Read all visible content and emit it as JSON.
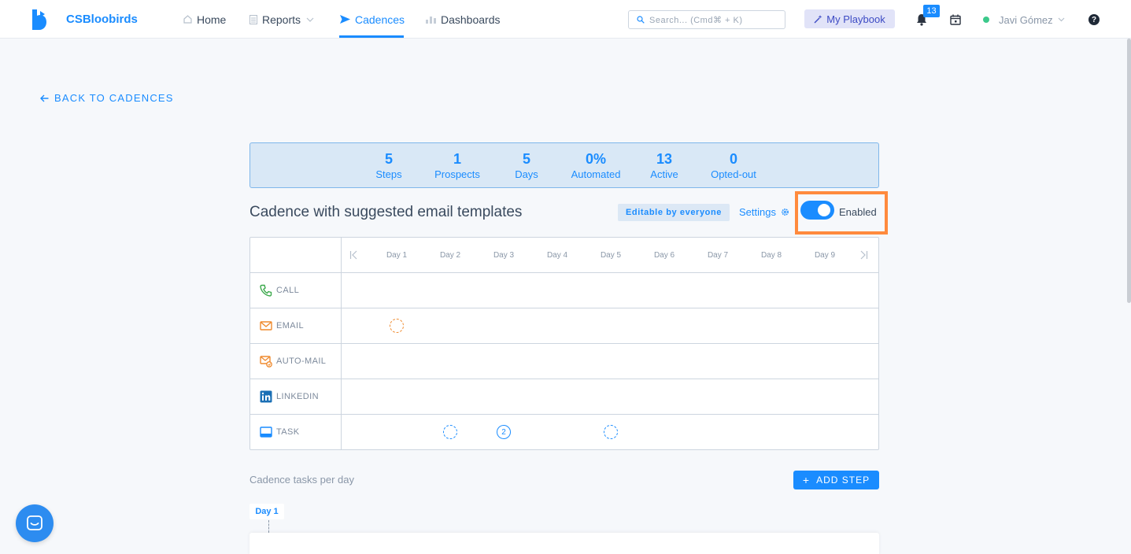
{
  "app": {
    "brand": "CSBloobirds"
  },
  "nav": {
    "items": [
      {
        "label": "Home",
        "icon": "home-icon"
      },
      {
        "label": "Reports",
        "icon": "reports-icon"
      },
      {
        "label": "Cadences",
        "icon": "send-icon",
        "active": true
      },
      {
        "label": "Dashboards",
        "icon": "bar-chart-icon"
      }
    ]
  },
  "search": {
    "placeholder": "Search... (Cmd⌘ + K)"
  },
  "playbook": {
    "label": "My Playbook"
  },
  "notifications": {
    "count": "13"
  },
  "user": {
    "name": "Javi Gómez",
    "status_color": "#3cc98b"
  },
  "help": {
    "glyph": "?"
  },
  "back_link": {
    "label": "BACK TO CADENCES"
  },
  "stats": [
    {
      "value": "5",
      "label": "Steps"
    },
    {
      "value": "1",
      "label": "Prospects"
    },
    {
      "value": "5",
      "label": "Days"
    },
    {
      "value": "0%",
      "label": "Automated"
    },
    {
      "value": "13",
      "label": "Active"
    },
    {
      "value": "0",
      "label": "Opted-out"
    }
  ],
  "cadence": {
    "title": "Cadence with suggested email templates",
    "editable_badge": "Editable by everyone",
    "settings_label": "Settings",
    "enabled_label": "Enabled",
    "enabled": true
  },
  "grid": {
    "days": [
      "Day 1",
      "Day 2",
      "Day 3",
      "Day 4",
      "Day 5",
      "Day 6",
      "Day 7",
      "Day 8",
      "Day 9"
    ],
    "rows": [
      {
        "label": "CALL",
        "icon": "phone-icon",
        "color": "#3aa84a"
      },
      {
        "label": "EMAIL",
        "icon": "mail-icon",
        "color": "#ef8a2e"
      },
      {
        "label": "AUTO-MAIL",
        "icon": "auto-mail-icon",
        "color": "#ef8a2e"
      },
      {
        "label": "LINKEDIN",
        "icon": "linkedin-icon",
        "color": "#1a6fb5"
      },
      {
        "label": "TASK",
        "icon": "task-icon",
        "color": "#1a8cff"
      }
    ],
    "steps": [
      {
        "row": "EMAIL",
        "day": "Day 1",
        "count": ""
      },
      {
        "row": "TASK",
        "day": "Day 2",
        "count": ""
      },
      {
        "row": "TASK",
        "day": "Day 3",
        "count": "2"
      },
      {
        "row": "TASK",
        "day": "Day 5",
        "count": ""
      }
    ]
  },
  "bottom": {
    "tasks_per_day": "Cadence tasks per day",
    "add_step": "ADD STEP",
    "day_chip": "Day 1"
  },
  "colors": {
    "accent": "#1a8cff",
    "highlight": "#ff8a3d"
  }
}
